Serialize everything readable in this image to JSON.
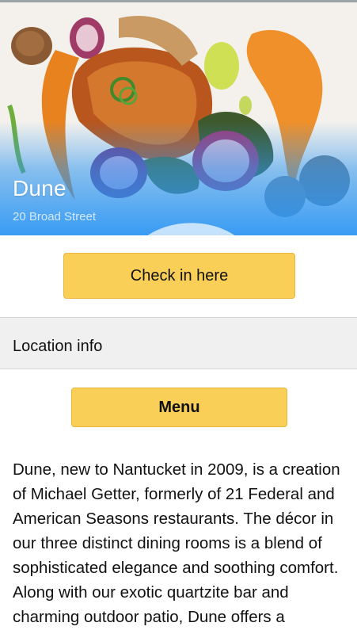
{
  "venue": {
    "name": "Dune",
    "address": "20 Broad Street"
  },
  "icons": {
    "address_icon": "map-pin-icon"
  },
  "colors": {
    "accent_button": "#f9cf57",
    "hero_overlay": "#2894f4",
    "section_bar": "#f0f0f0"
  },
  "actions": {
    "check_in_label": "Check in here",
    "menu_label": "Menu"
  },
  "section": {
    "title": "Location info"
  },
  "description": "Dune, new to Nantucket in 2009, is a creation of Michael Getter, formerly of 21 Federal and American Seasons restaurants. The décor in our three distinct dining rooms is a blend of sophisticated elegance and soothing comfort. Along with our exotic quartzite bar and charming outdoor patio, Dune offers a stunning selection of"
}
